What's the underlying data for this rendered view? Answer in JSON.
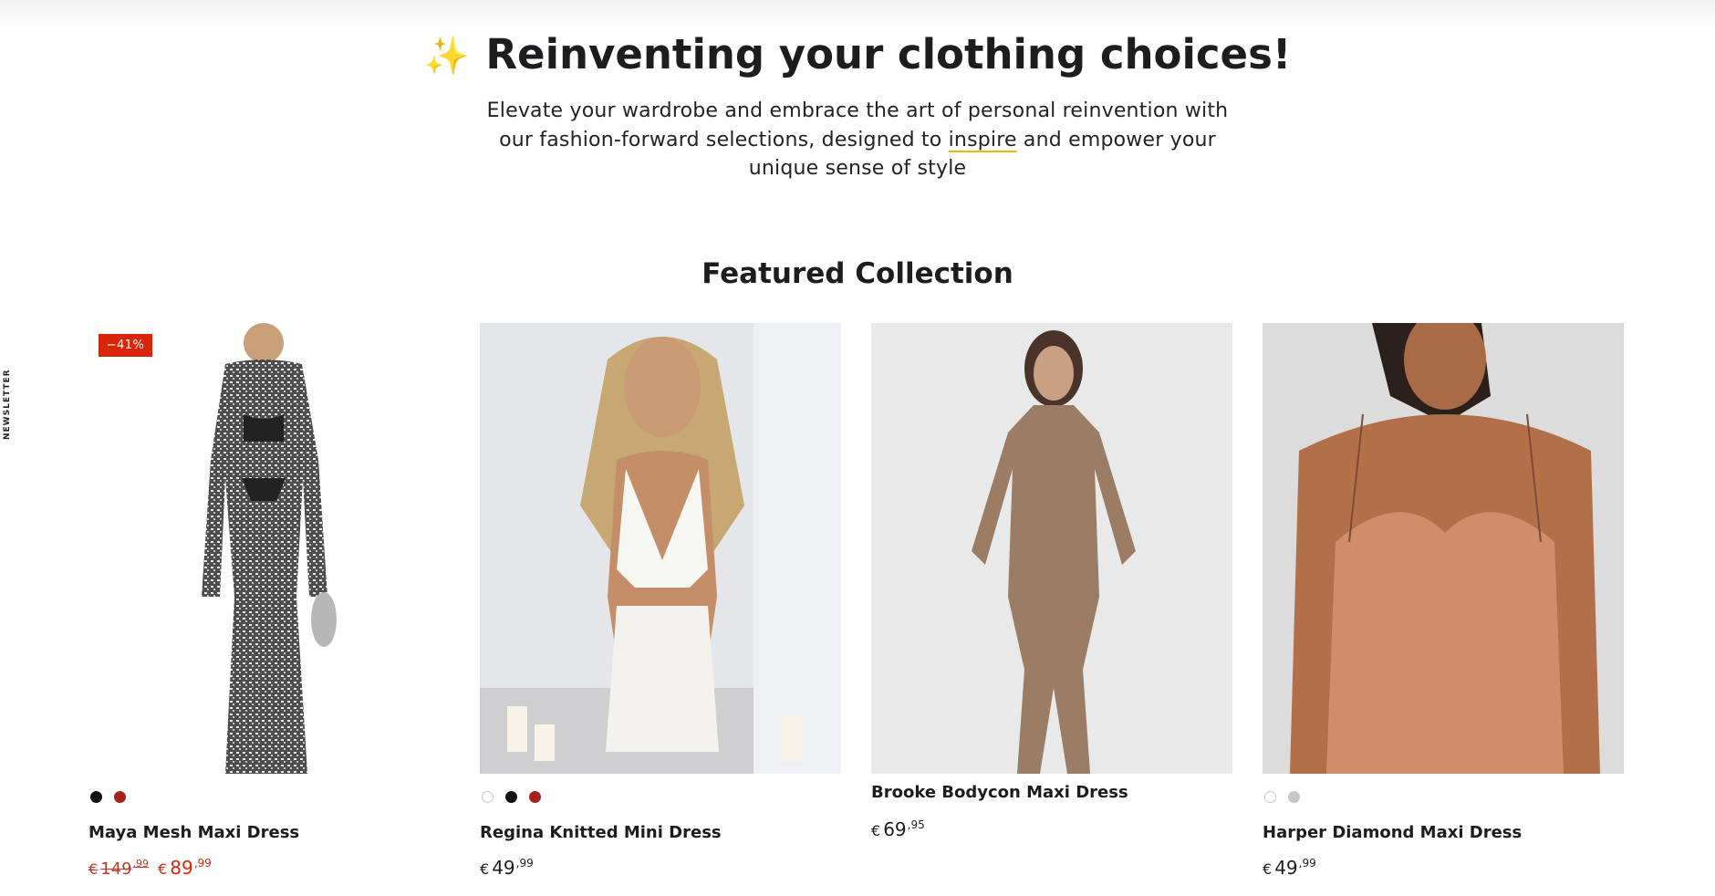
{
  "hero": {
    "title": "Reinventing your clothing choices!",
    "sparkle_icon": "sparkles-icon",
    "desc_part1": "Elevate your wardrobe and embrace the art of personal reinvention with our fashion-forward selections, designed to ",
    "desc_highlight": "inspire",
    "desc_part2": " and empower your unique sense of style"
  },
  "newsletter_tab": "NEWSLETTER",
  "section_title": "Featured Collection",
  "colors": {
    "accent": "#f5b400",
    "sale": "#d9260b",
    "text": "#1d1d1f"
  },
  "products": [
    {
      "name": "Maya Mesh Maxi Dress",
      "badge": "−41%",
      "swatches": [
        "black",
        "red"
      ],
      "compare_price": {
        "currency": "€",
        "main": "149",
        "cents": ",99"
      },
      "price": {
        "currency": "€",
        "main": "89",
        "cents": ",99"
      }
    },
    {
      "name": "Regina Knitted Mini Dress",
      "swatches": [
        "white",
        "black",
        "red"
      ],
      "price": {
        "currency": "€",
        "main": "49",
        "cents": ",99"
      }
    },
    {
      "name": "Brooke Bodycon Maxi Dress",
      "swatches": [],
      "price": {
        "currency": "€",
        "main": "69",
        "cents": ",95"
      }
    },
    {
      "name": "Harper Diamond Maxi Dress",
      "swatches": [
        "white",
        "silver"
      ],
      "price": {
        "currency": "€",
        "main": "49",
        "cents": ",99"
      }
    }
  ]
}
